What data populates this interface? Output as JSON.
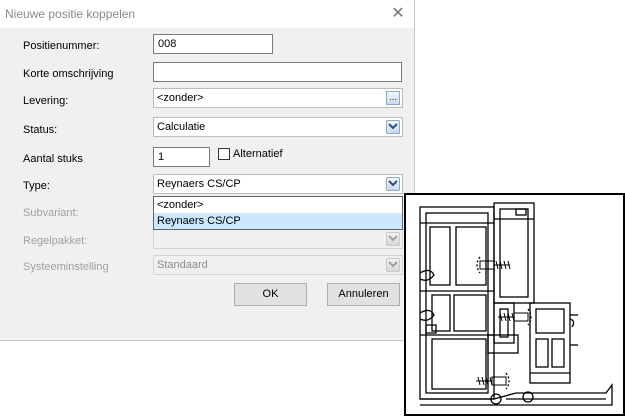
{
  "dialog": {
    "title": "Nieuwe positie koppelen",
    "close_glyph": "✕",
    "fields": {
      "positienummer": {
        "label": "Positienummer:",
        "value": "008"
      },
      "korte_omschrijving": {
        "label": "Korte omschrijving",
        "value": ""
      },
      "levering": {
        "label": "Levering:",
        "value": "<zonder>",
        "button": "..."
      },
      "status": {
        "label": "Status:",
        "value": "Calculatie"
      },
      "aantal_stuks": {
        "label": "Aantal stuks",
        "value": "1"
      },
      "alternatief": {
        "label": "Alternatief",
        "checked": false
      },
      "type": {
        "label": "Type:",
        "value": "Reynaers CS/CP",
        "options": [
          "<zonder>",
          "Reynaers CS/CP"
        ],
        "selected_index": 1
      },
      "subvariant": {
        "label": "Subvariant:",
        "value": ""
      },
      "regelpakket": {
        "label": "Regelpakket:",
        "value": ""
      },
      "systeeminstelling": {
        "label": "Systeeminstelling",
        "value": "Standaard"
      }
    },
    "buttons": {
      "ok": "OK",
      "cancel": "Annuleren"
    }
  },
  "colors": {
    "dropdown_selection": "#cce8ff",
    "dialog_background": "#f0f0f0",
    "disabled_text": "#a0a0a0"
  },
  "icons": [
    "close-icon",
    "chevron-down-icon",
    "ellipsis-icon"
  ],
  "profile_image": {
    "description": "CAD cross-section of window frame profile",
    "stroke": "#000000"
  }
}
